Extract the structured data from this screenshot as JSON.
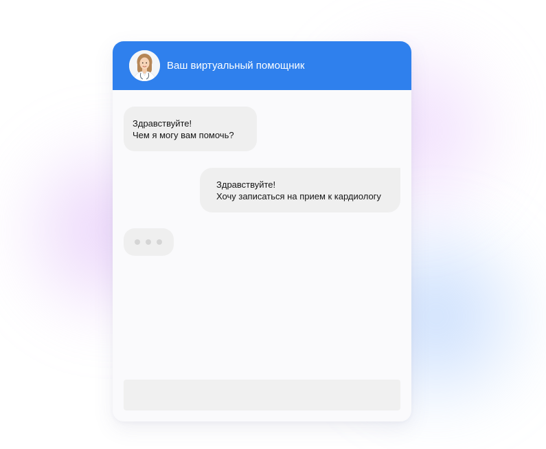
{
  "header": {
    "title": "Ваш виртуальный помощник",
    "avatar_icon": "doctor-avatar",
    "background_color": "#2f80ed"
  },
  "messages": [
    {
      "sender": "bot",
      "lines": [
        "Здравствуйте!",
        "Чем я могу вам помочь?"
      ]
    },
    {
      "sender": "user",
      "lines": [
        "Здравствуйте!",
        "Хочу записаться на прием к кардиологу"
      ]
    }
  ],
  "typing_indicator": {
    "sender": "bot",
    "icon": "typing-dots-icon"
  },
  "input": {
    "value": "",
    "placeholder": ""
  },
  "colors": {
    "accent": "#2f80ed",
    "bubble": "#efefef",
    "window": "#fafafc",
    "input": "#f0f0f0"
  }
}
